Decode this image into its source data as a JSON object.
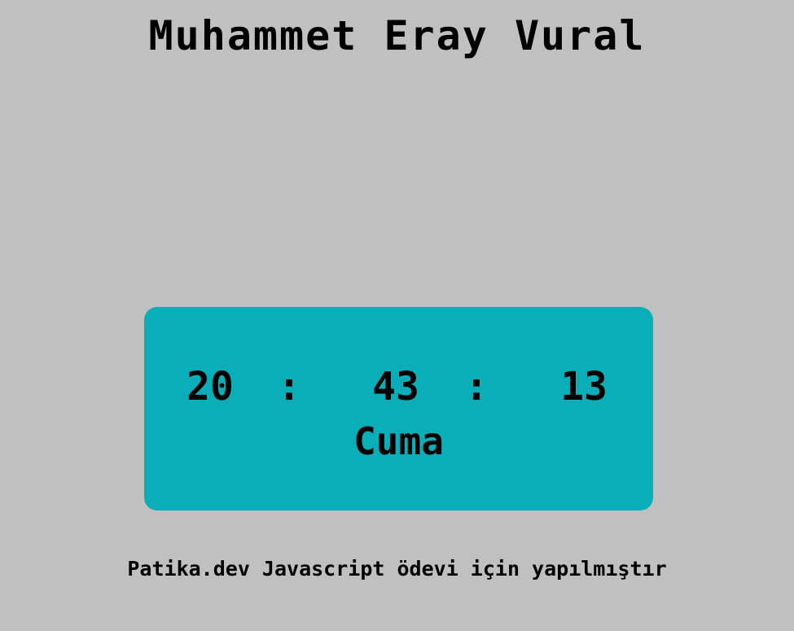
{
  "header": {
    "title": "Muhammet Eray Vural"
  },
  "clock": {
    "hours": "20",
    "minutes": "43",
    "seconds": "13",
    "separator": ":",
    "day": "Cuma",
    "card_color": "#0aaeb8"
  },
  "footer": {
    "text": "Patika.dev Javascript ödevi için yapılmıştır"
  },
  "colors": {
    "background": "#c0c0c0",
    "text": "#000000"
  }
}
